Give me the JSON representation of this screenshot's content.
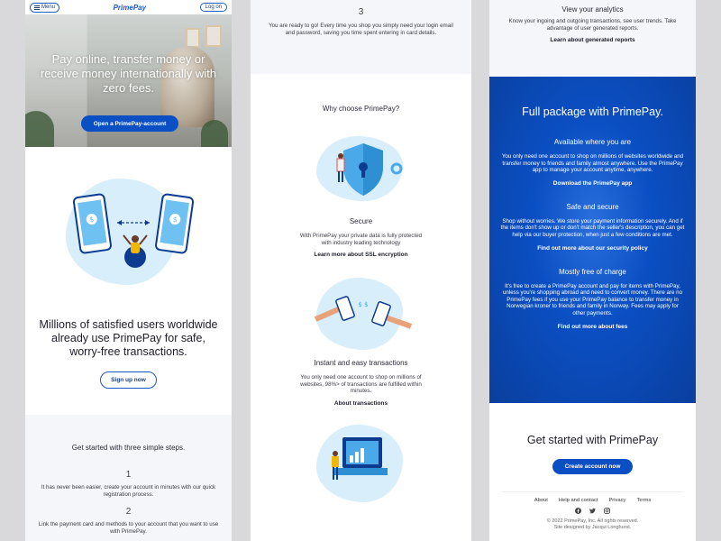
{
  "header": {
    "menu_label": "Menu",
    "logo": "PrimePay",
    "login_label": "Log on"
  },
  "hero": {
    "headline": "Pay online, transfer money or receive money internationally with zero fees.",
    "cta": "Open a PrimePay-account"
  },
  "users": {
    "heading": "Millions of satisfied users worldwide already use PrimePay for safe, worry-free transactions.",
    "cta": "Sign up now"
  },
  "steps": {
    "heading": "Get started with three simple steps.",
    "items": [
      {
        "number": "1",
        "text": "It has never been easier, create your account in minutes with our quick registration process."
      },
      {
        "number": "2",
        "text": "Link the payment card and methods to your account that you want to use with PrimePay."
      },
      {
        "number": "3",
        "text": "You are ready to go! Every time you shop you simply need your login email and password, saving you time spent entering in card details."
      }
    ]
  },
  "why": {
    "heading": "Why choose PrimePay?",
    "features": [
      {
        "title": "Secure",
        "text": "With PrimePay your private data is fully protected with industry leading technology",
        "link": "Learn more about SSL encryption"
      },
      {
        "title": "Instant and easy transactions",
        "text": "You only need one account to shop on millions of websites, 98%> of transactions are fulfilled within minutes.",
        "link": "About transactions"
      }
    ]
  },
  "analytics": {
    "title": "View your analytics",
    "text": "Know your ingoing and outgoing transactions, see user trends. Take advantage of user generated reports.",
    "link": "Learn about generated reports"
  },
  "full_package": {
    "heading": "Full package with PrimePay.",
    "sections": [
      {
        "title": "Available where you are",
        "text": "You only need one account to shop on millions of websites worldwide and transfer money to friends and family almost anywhere. Use the PrimePay app to manage your account anytime, anywhere.",
        "link": "Download the PrimePay app"
      },
      {
        "title": "Safe and secure",
        "text": "Shop without worries. We store your payment information securely. And if the items don't show up or don't match the seller's description, you can get help via our buyer protection, when just a few conditions are met.",
        "link": "Find out more about our security policy"
      },
      {
        "title": "Mostly free of charge",
        "text": "It's free to create a PrimePay account and pay for items with PrimePay, unless you're shopping abroad and need to convert money. There are no PrimePay fees if you use your PrimePay balance to transfer money in Norwegian kroner to friends and family in Norway. Fees may apply for other payments.",
        "link": "Find out more about fees"
      }
    ]
  },
  "get_started": {
    "heading": "Get started with PrimePay",
    "cta": "Create account now"
  },
  "footer": {
    "links": [
      "About",
      "Help and contact",
      "Privacy",
      "Terms"
    ],
    "copyright": "© 2022 PrimePay, Inc. All rights reserved.",
    "credit": "Site designed by Jacqui Longhurst."
  },
  "colors": {
    "brand": "#0b4fc4",
    "brand_dark": "#0a3f9e",
    "illustration_bg": "#d8eefb"
  }
}
